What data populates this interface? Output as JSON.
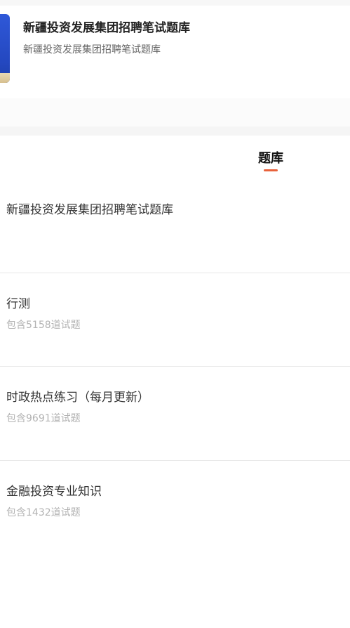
{
  "header": {
    "title": "新疆投资发展集团招聘笔试题库",
    "subtitle": "新疆投资发展集团招聘笔试题库"
  },
  "tabs": [
    {
      "label": "题库",
      "active": true
    }
  ],
  "bank": {
    "title": "新疆投资发展集团招聘笔试题库"
  },
  "categories": [
    {
      "name": "行测",
      "count_text": "包含5158道试题"
    },
    {
      "name": "时政热点练习（每月更新）",
      "count_text": "包含9691道试题"
    },
    {
      "name": "金融投资专业知识",
      "count_text": "包含1432道试题"
    }
  ],
  "colors": {
    "accent": "#e8623c",
    "cover_blue": "#2f58d8"
  }
}
